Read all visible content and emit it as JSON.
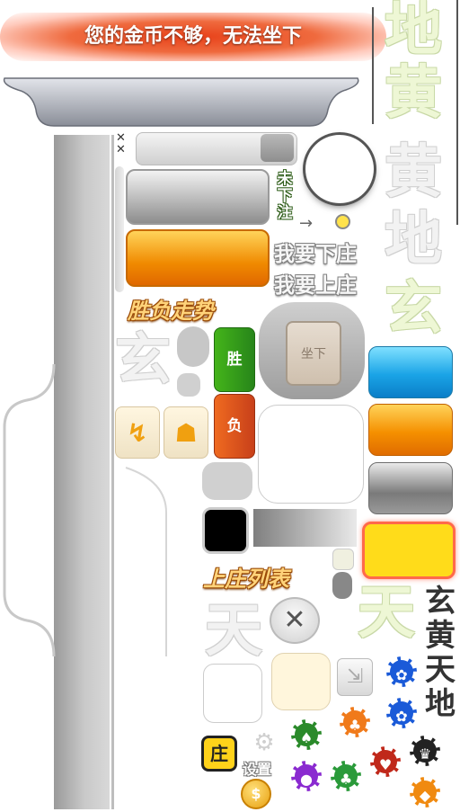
{
  "banner": {
    "text": "您的金币不够，无法坐下"
  },
  "labels": {
    "not_bet": "未下注",
    "want_down": "我要下庄",
    "want_up": "我要上庄",
    "win_lose_trend": "胜负走势",
    "seat_down": "坐下",
    "win": "胜",
    "lose": "负",
    "banker_list": "上庄列表",
    "settings": "设置",
    "banker": "庄",
    "xx": "××"
  },
  "fade_chars": {
    "di": "地",
    "huang": "黄",
    "huang2": "黄",
    "di2": "地",
    "xuan_right": "玄",
    "xuan_left": "玄",
    "tian_left": "天",
    "tian_right": "天"
  },
  "vertical_title": [
    "玄",
    "黄",
    "天",
    "地"
  ],
  "colors": {
    "banner": "#e8421a",
    "orange": "#f08a00",
    "blue": "#1aa4e6",
    "green": "#27851a",
    "red": "#c8401a",
    "yellow": "#ffdc1a"
  },
  "chips": [
    {
      "color": "#2a8a2a",
      "glyph": "♠"
    },
    {
      "color": "#f07a1a",
      "glyph": "♣"
    },
    {
      "color": "#1a5ad8",
      "glyph": "✿"
    },
    {
      "color": "#1a5ad8",
      "glyph": "✿"
    },
    {
      "color": "#222222",
      "glyph": "♛"
    },
    {
      "color": "#c0281a",
      "glyph": "♥"
    },
    {
      "color": "#2a9a3a",
      "glyph": "♣"
    },
    {
      "color": "#8a2ad0",
      "glyph": "●"
    },
    {
      "color": "#f08a10",
      "glyph": "◆"
    }
  ]
}
